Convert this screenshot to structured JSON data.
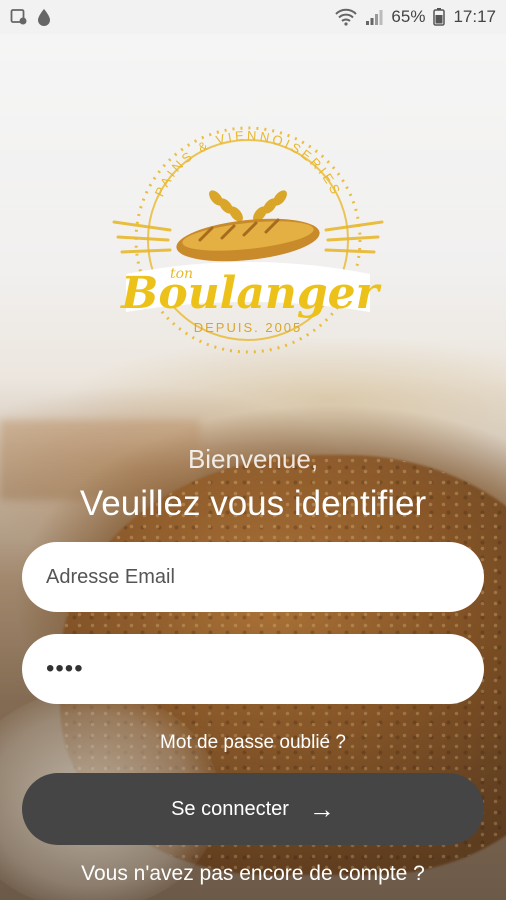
{
  "status_bar": {
    "battery": "65%",
    "time": "17:17",
    "icons": [
      "screen-record-icon",
      "drop-icon",
      "wifi-icon",
      "signal-icon",
      "battery-icon"
    ]
  },
  "logo": {
    "arc_text": "PAINS & VIENNOISERIES",
    "small_text": "ton",
    "brand": "Boulanger",
    "since": "DEPUIS. 2005",
    "color": "#e8b82d"
  },
  "welcome": "Bienvenue,",
  "title": "Veuillez vous identifier",
  "email": {
    "placeholder": "Adresse Email",
    "value": ""
  },
  "password": {
    "value": "••••"
  },
  "forgot_link": "Mot de passe oublié ?",
  "connect_button": {
    "label": "Se connecter",
    "icon": "arrow-right-icon"
  },
  "signup_link": "Vous n'avez pas encore de compte ?",
  "colors": {
    "button": "#454545",
    "field": "#ffffff",
    "text": "#ffffff"
  }
}
